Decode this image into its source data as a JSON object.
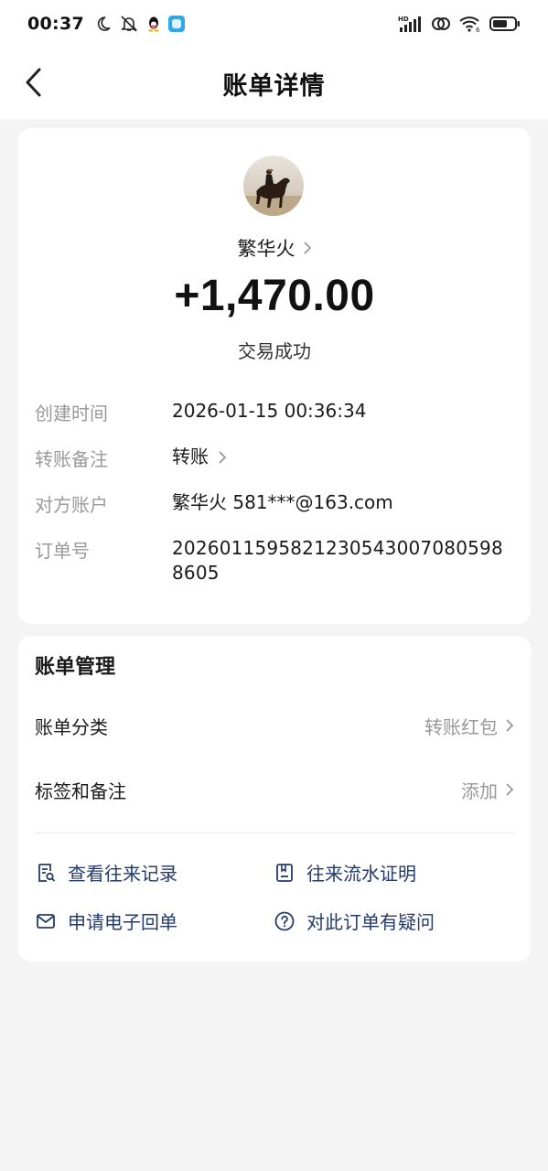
{
  "status_bar": {
    "time": "00:37",
    "hd_label": "HD",
    "wifi_sub": "6",
    "icons": [
      "moon-icon",
      "mute-icon",
      "qq-icon",
      "app-icon",
      "signal-icon",
      "link-icon",
      "wifi-icon",
      "battery-icon"
    ]
  },
  "nav": {
    "title": "账单详情"
  },
  "transaction": {
    "payee": "繁华火",
    "amount": "+1,470.00",
    "status": "交易成功",
    "details": [
      {
        "label": "创建时间",
        "value": "2026-01-15 00:36:34"
      },
      {
        "label": "转账备注",
        "value": "转账"
      },
      {
        "label": "对方账户",
        "value": "繁华火 581***@163.com"
      },
      {
        "label": "订单号",
        "value": "2026011595821230543007080598 8605"
      }
    ]
  },
  "management": {
    "title": "账单管理",
    "rows": [
      {
        "label": "账单分类",
        "value": "转账红包"
      },
      {
        "label": "标签和备注",
        "value": "添加"
      }
    ],
    "actions": [
      {
        "label": "查看往来记录",
        "icon": "record-search-icon"
      },
      {
        "label": "往来流水证明",
        "icon": "statement-icon"
      },
      {
        "label": "申请电子回单",
        "icon": "mail-icon"
      },
      {
        "label": "对此订单有疑问",
        "icon": "question-icon"
      }
    ]
  },
  "colors": {
    "background": "#f4f4f4",
    "card": "#ffffff",
    "action_text": "#233a6a",
    "muted": "#9a9a9a"
  }
}
